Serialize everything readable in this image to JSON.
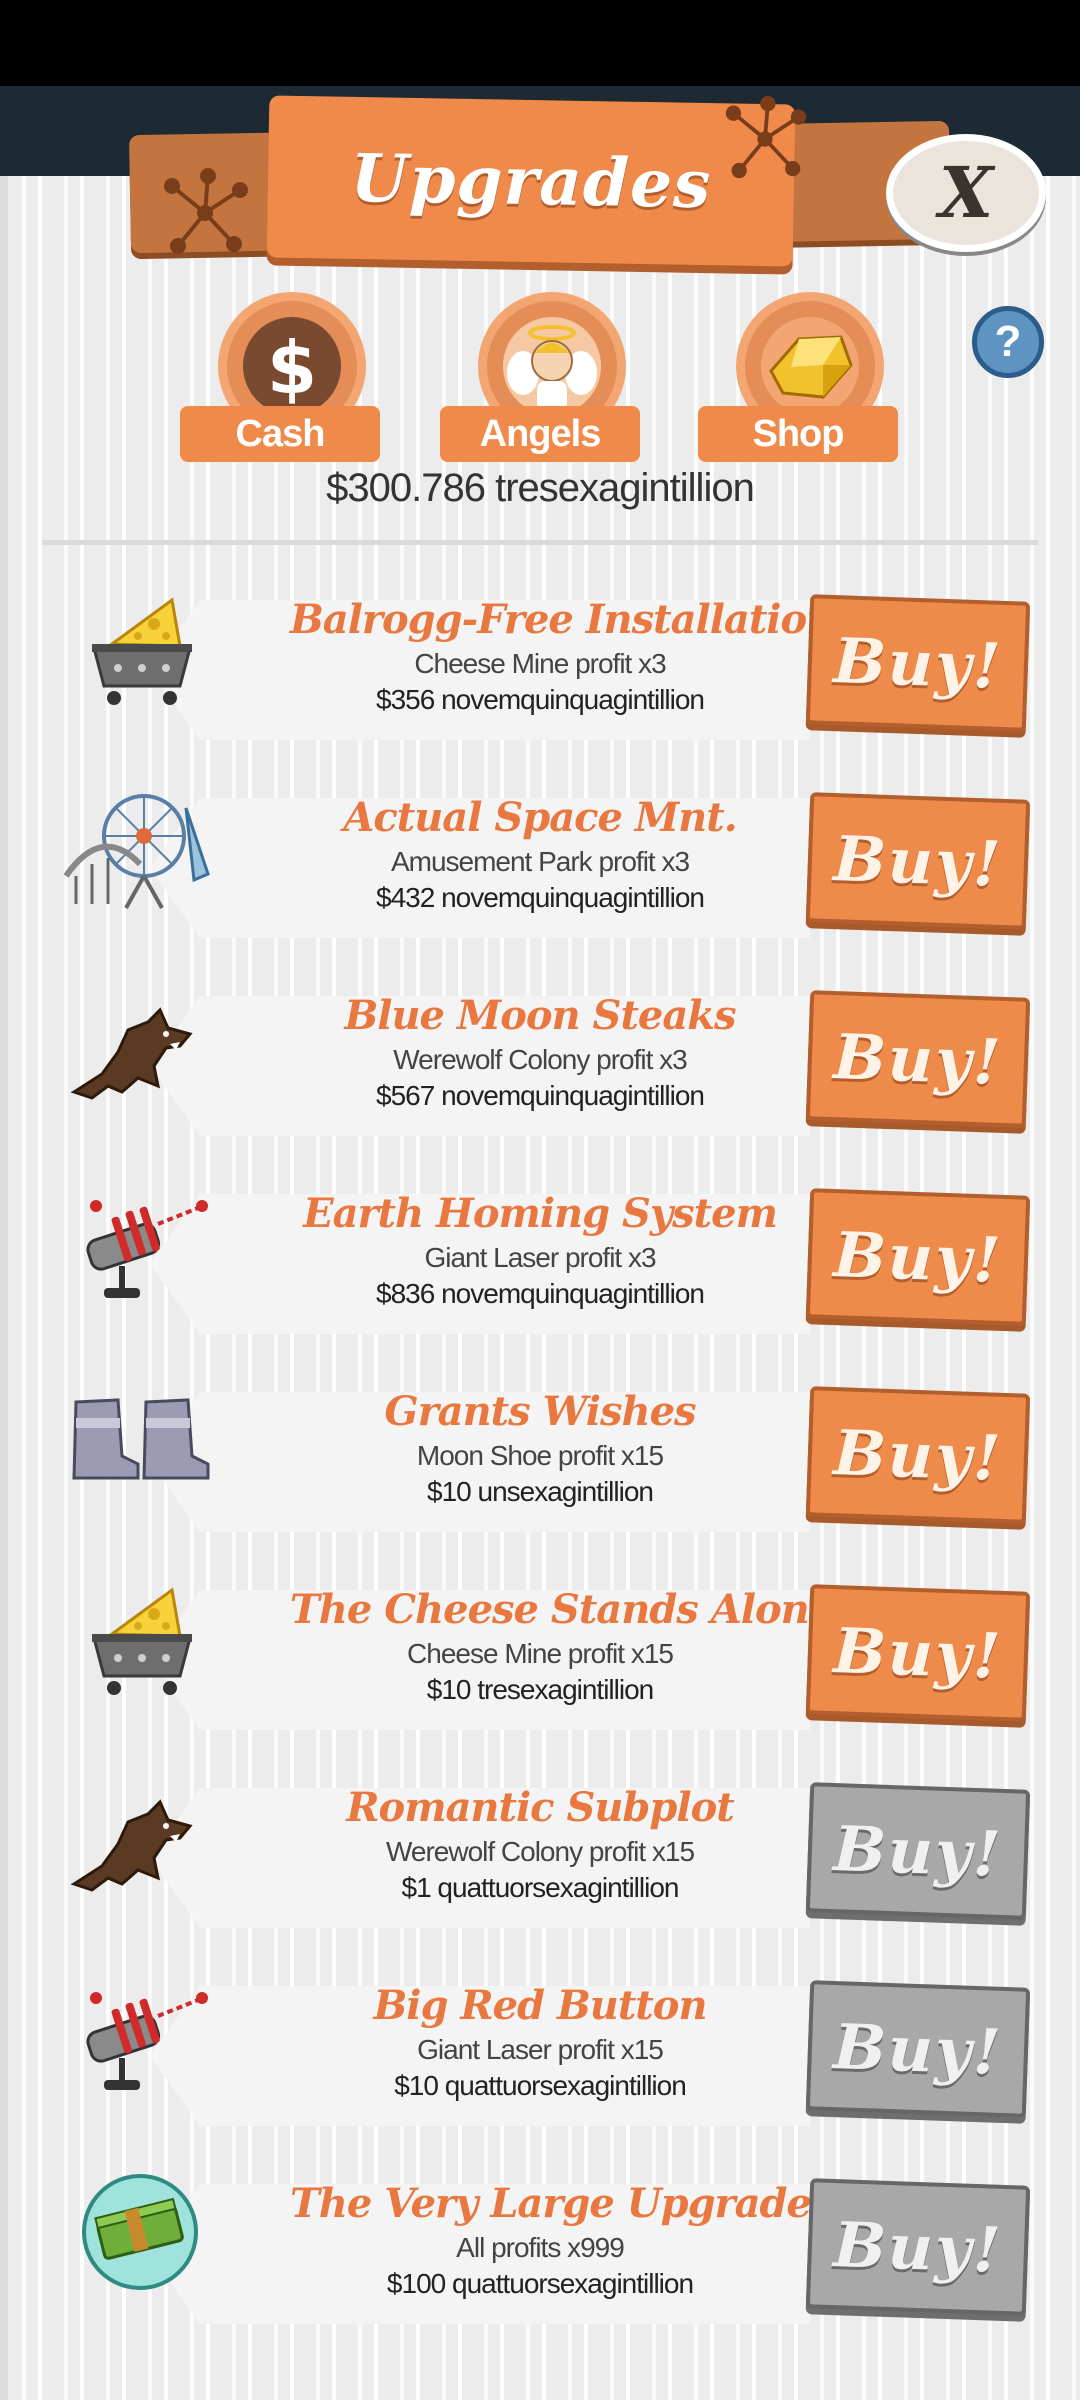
{
  "header": {
    "title": "Upgrades",
    "close_label": "X"
  },
  "tabs": [
    {
      "label": "Cash",
      "icon": "dollar-icon"
    },
    {
      "label": "Angels",
      "icon": "angel-icon"
    },
    {
      "label": "Shop",
      "icon": "gold-gem-icon"
    }
  ],
  "help_label": "?",
  "balance": "$300.786 tresexagintillion",
  "upgrades": [
    {
      "title": "Balrogg-Free Installations",
      "description": "Cheese Mine profit x3",
      "cost": "$356 novemquinquagintillion",
      "buy_label": "Buy!",
      "icon": "cheese-mine-icon",
      "affordable": true
    },
    {
      "title": "Actual Space Mnt.",
      "description": "Amusement Park profit x3",
      "cost": "$432 novemquinquagintillion",
      "buy_label": "Buy!",
      "icon": "amusement-park-icon",
      "affordable": true
    },
    {
      "title": "Blue Moon Steaks",
      "description": "Werewolf Colony profit x3",
      "cost": "$567 novemquinquagintillion",
      "buy_label": "Buy!",
      "icon": "werewolf-icon",
      "affordable": true
    },
    {
      "title": "Earth Homing System",
      "description": "Giant Laser profit x3",
      "cost": "$836 novemquinquagintillion",
      "buy_label": "Buy!",
      "icon": "giant-laser-icon",
      "affordable": true
    },
    {
      "title": "Grants Wishes",
      "description": "Moon Shoe profit x15",
      "cost": "$10 unsexagintillion",
      "buy_label": "Buy!",
      "icon": "moon-shoe-icon",
      "affordable": true
    },
    {
      "title": "The Cheese Stands Alone",
      "description": "Cheese Mine profit x15",
      "cost": "$10 tresexagintillion",
      "buy_label": "Buy!",
      "icon": "cheese-mine-icon",
      "affordable": true
    },
    {
      "title": "Romantic Subplot",
      "description": "Werewolf Colony profit x15",
      "cost": "$1 quattuorsexagintillion",
      "buy_label": "Buy!",
      "icon": "werewolf-icon",
      "affordable": false
    },
    {
      "title": "Big Red Button",
      "description": "Giant Laser profit x15",
      "cost": "$10 quattuorsexagintillion",
      "buy_label": "Buy!",
      "icon": "giant-laser-icon",
      "affordable": false
    },
    {
      "title": "The Very Large Upgrade",
      "description": "All profits x999",
      "cost": "$100 quattuorsexagintillion",
      "buy_label": "Buy!",
      "icon": "money-stack-icon",
      "affordable": false
    }
  ]
}
